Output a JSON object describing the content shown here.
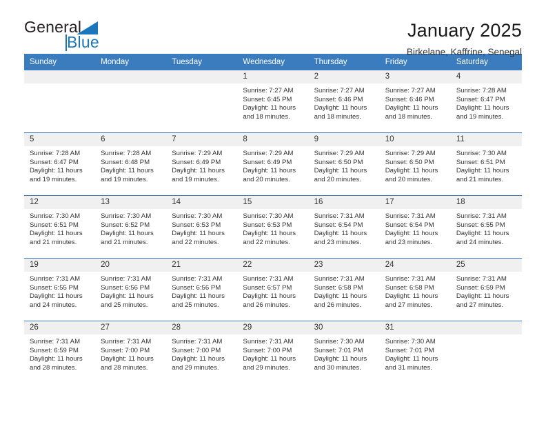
{
  "brand": {
    "name_top": "General",
    "name_bottom": "Blue",
    "accent_color": "#1c76bc"
  },
  "header": {
    "title": "January 2025",
    "subtitle": "Birkelane, Kaffrine, Senegal"
  },
  "theme": {
    "header_blue": "#3a7cbe",
    "daynum_bg": "#f0f0f0",
    "text": "#333333"
  },
  "weekdays": [
    "Sunday",
    "Monday",
    "Tuesday",
    "Wednesday",
    "Thursday",
    "Friday",
    "Saturday"
  ],
  "weeks": [
    [
      {
        "day": "",
        "empty": true
      },
      {
        "day": "",
        "empty": true
      },
      {
        "day": "",
        "empty": true
      },
      {
        "day": "1",
        "sunrise": "Sunrise: 7:27 AM",
        "sunset": "Sunset: 6:45 PM",
        "daylight": "Daylight: 11 hours and 18 minutes."
      },
      {
        "day": "2",
        "sunrise": "Sunrise: 7:27 AM",
        "sunset": "Sunset: 6:46 PM",
        "daylight": "Daylight: 11 hours and 18 minutes."
      },
      {
        "day": "3",
        "sunrise": "Sunrise: 7:27 AM",
        "sunset": "Sunset: 6:46 PM",
        "daylight": "Daylight: 11 hours and 18 minutes."
      },
      {
        "day": "4",
        "sunrise": "Sunrise: 7:28 AM",
        "sunset": "Sunset: 6:47 PM",
        "daylight": "Daylight: 11 hours and 19 minutes."
      }
    ],
    [
      {
        "day": "5",
        "sunrise": "Sunrise: 7:28 AM",
        "sunset": "Sunset: 6:47 PM",
        "daylight": "Daylight: 11 hours and 19 minutes."
      },
      {
        "day": "6",
        "sunrise": "Sunrise: 7:28 AM",
        "sunset": "Sunset: 6:48 PM",
        "daylight": "Daylight: 11 hours and 19 minutes."
      },
      {
        "day": "7",
        "sunrise": "Sunrise: 7:29 AM",
        "sunset": "Sunset: 6:49 PM",
        "daylight": "Daylight: 11 hours and 19 minutes."
      },
      {
        "day": "8",
        "sunrise": "Sunrise: 7:29 AM",
        "sunset": "Sunset: 6:49 PM",
        "daylight": "Daylight: 11 hours and 20 minutes."
      },
      {
        "day": "9",
        "sunrise": "Sunrise: 7:29 AM",
        "sunset": "Sunset: 6:50 PM",
        "daylight": "Daylight: 11 hours and 20 minutes."
      },
      {
        "day": "10",
        "sunrise": "Sunrise: 7:29 AM",
        "sunset": "Sunset: 6:50 PM",
        "daylight": "Daylight: 11 hours and 20 minutes."
      },
      {
        "day": "11",
        "sunrise": "Sunrise: 7:30 AM",
        "sunset": "Sunset: 6:51 PM",
        "daylight": "Daylight: 11 hours and 21 minutes."
      }
    ],
    [
      {
        "day": "12",
        "sunrise": "Sunrise: 7:30 AM",
        "sunset": "Sunset: 6:51 PM",
        "daylight": "Daylight: 11 hours and 21 minutes."
      },
      {
        "day": "13",
        "sunrise": "Sunrise: 7:30 AM",
        "sunset": "Sunset: 6:52 PM",
        "daylight": "Daylight: 11 hours and 21 minutes."
      },
      {
        "day": "14",
        "sunrise": "Sunrise: 7:30 AM",
        "sunset": "Sunset: 6:53 PM",
        "daylight": "Daylight: 11 hours and 22 minutes."
      },
      {
        "day": "15",
        "sunrise": "Sunrise: 7:30 AM",
        "sunset": "Sunset: 6:53 PM",
        "daylight": "Daylight: 11 hours and 22 minutes."
      },
      {
        "day": "16",
        "sunrise": "Sunrise: 7:31 AM",
        "sunset": "Sunset: 6:54 PM",
        "daylight": "Daylight: 11 hours and 23 minutes."
      },
      {
        "day": "17",
        "sunrise": "Sunrise: 7:31 AM",
        "sunset": "Sunset: 6:54 PM",
        "daylight": "Daylight: 11 hours and 23 minutes."
      },
      {
        "day": "18",
        "sunrise": "Sunrise: 7:31 AM",
        "sunset": "Sunset: 6:55 PM",
        "daylight": "Daylight: 11 hours and 24 minutes."
      }
    ],
    [
      {
        "day": "19",
        "sunrise": "Sunrise: 7:31 AM",
        "sunset": "Sunset: 6:55 PM",
        "daylight": "Daylight: 11 hours and 24 minutes."
      },
      {
        "day": "20",
        "sunrise": "Sunrise: 7:31 AM",
        "sunset": "Sunset: 6:56 PM",
        "daylight": "Daylight: 11 hours and 25 minutes."
      },
      {
        "day": "21",
        "sunrise": "Sunrise: 7:31 AM",
        "sunset": "Sunset: 6:56 PM",
        "daylight": "Daylight: 11 hours and 25 minutes."
      },
      {
        "day": "22",
        "sunrise": "Sunrise: 7:31 AM",
        "sunset": "Sunset: 6:57 PM",
        "daylight": "Daylight: 11 hours and 26 minutes."
      },
      {
        "day": "23",
        "sunrise": "Sunrise: 7:31 AM",
        "sunset": "Sunset: 6:58 PM",
        "daylight": "Daylight: 11 hours and 26 minutes."
      },
      {
        "day": "24",
        "sunrise": "Sunrise: 7:31 AM",
        "sunset": "Sunset: 6:58 PM",
        "daylight": "Daylight: 11 hours and 27 minutes."
      },
      {
        "day": "25",
        "sunrise": "Sunrise: 7:31 AM",
        "sunset": "Sunset: 6:59 PM",
        "daylight": "Daylight: 11 hours and 27 minutes."
      }
    ],
    [
      {
        "day": "26",
        "sunrise": "Sunrise: 7:31 AM",
        "sunset": "Sunset: 6:59 PM",
        "daylight": "Daylight: 11 hours and 28 minutes."
      },
      {
        "day": "27",
        "sunrise": "Sunrise: 7:31 AM",
        "sunset": "Sunset: 7:00 PM",
        "daylight": "Daylight: 11 hours and 28 minutes."
      },
      {
        "day": "28",
        "sunrise": "Sunrise: 7:31 AM",
        "sunset": "Sunset: 7:00 PM",
        "daylight": "Daylight: 11 hours and 29 minutes."
      },
      {
        "day": "29",
        "sunrise": "Sunrise: 7:31 AM",
        "sunset": "Sunset: 7:00 PM",
        "daylight": "Daylight: 11 hours and 29 minutes."
      },
      {
        "day": "30",
        "sunrise": "Sunrise: 7:30 AM",
        "sunset": "Sunset: 7:01 PM",
        "daylight": "Daylight: 11 hours and 30 minutes."
      },
      {
        "day": "31",
        "sunrise": "Sunrise: 7:30 AM",
        "sunset": "Sunset: 7:01 PM",
        "daylight": "Daylight: 11 hours and 31 minutes."
      },
      {
        "day": "",
        "empty": true
      }
    ]
  ]
}
